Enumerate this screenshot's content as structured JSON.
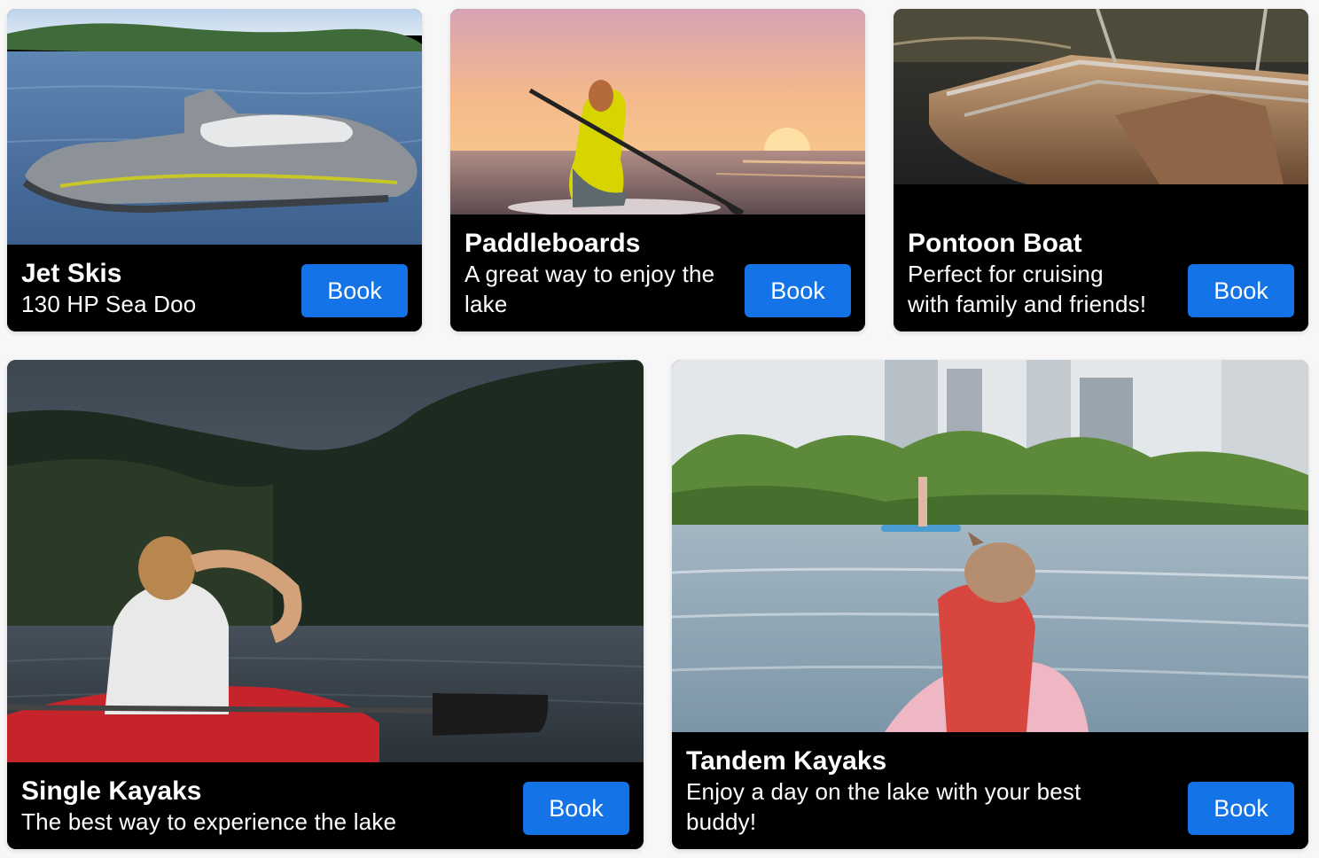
{
  "cards": [
    {
      "title": "Jet Skis",
      "subtitle": "130 HP Sea Doo",
      "button_label": "Book",
      "image": "jet-ski-on-lake-photo"
    },
    {
      "title": "Paddleboards",
      "subtitle": "A great way to enjoy the lake",
      "button_label": "Book",
      "image": "woman-on-paddleboard-at-sunset-photo"
    },
    {
      "title": "Pontoon Boat",
      "subtitle": "Perfect for cruising with family and friends!",
      "button_label": "Book",
      "image": "pontoon-boat-on-lake-photo"
    },
    {
      "title": "Single Kayaks",
      "subtitle": "The best way to experience the lake",
      "button_label": "Book",
      "image": "woman-in-red-kayak-photo"
    },
    {
      "title": "Tandem Kayaks",
      "subtitle": "Enjoy a day on the lake with your best buddy!",
      "button_label": "Book",
      "image": "dog-in-life-vest-on-kayak-photo"
    }
  ],
  "colors": {
    "card_background": "#000000",
    "button_background": "#1473e6",
    "text": "#ffffff",
    "page_background": "#f7f7f8"
  }
}
